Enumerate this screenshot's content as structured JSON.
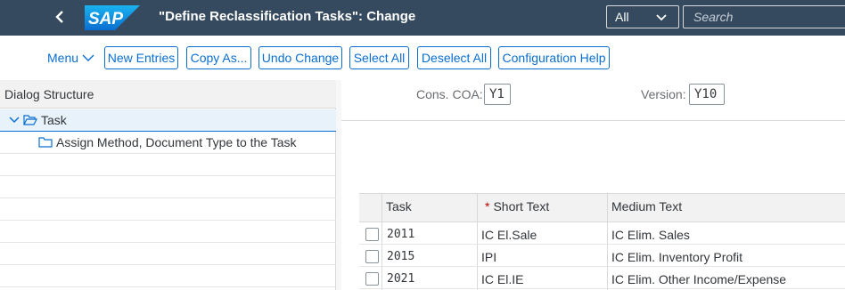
{
  "shell": {
    "logo_text": "SAP",
    "title": "\"Define Reclassification Tasks\": Change",
    "scope_select": "All",
    "search_placeholder": "Search"
  },
  "toolbar": {
    "menu_label": "Menu",
    "buttons": [
      "New Entries",
      "Copy As...",
      "Undo Change",
      "Select All",
      "Deselect All",
      "Configuration Help"
    ]
  },
  "dialog_structure": {
    "header": "Dialog Structure",
    "items": [
      {
        "label": "Task",
        "expanded": true,
        "selected": true
      },
      {
        "label": "Assign Method, Document Type to the Task"
      }
    ]
  },
  "filters": {
    "cons_coa_label": "Cons. COA:",
    "cons_coa_value": "Y1",
    "version_label": "Version:",
    "version_value": "Y10"
  },
  "table": {
    "columns": [
      "Task",
      "Short Text",
      "Medium Text"
    ],
    "required_marker": "*",
    "rows": [
      {
        "task": "2011",
        "short": "IC El.Sale",
        "medium": "IC Elim. Sales"
      },
      {
        "task": "2015",
        "short": "IPI",
        "medium": "IC Elim. Inventory Profit"
      },
      {
        "task": "2021",
        "short": "IC El.IE",
        "medium": "IC Elim. Other Income/Expense"
      }
    ]
  },
  "colors": {
    "shell_bg": "#354a5f",
    "accent": "#0a6ed1",
    "required": "#bb0000"
  }
}
